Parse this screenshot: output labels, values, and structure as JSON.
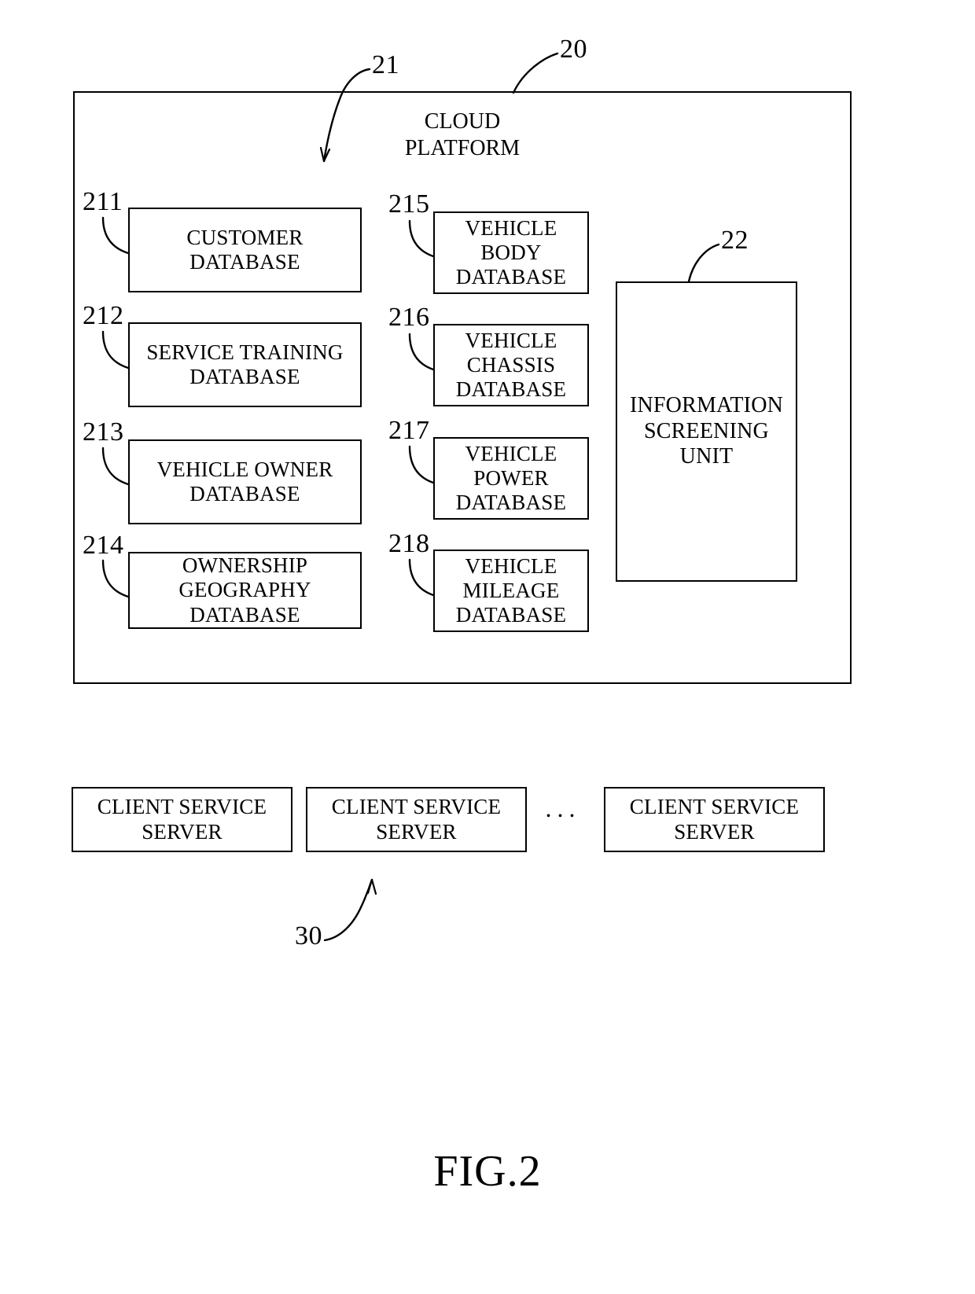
{
  "figure": {
    "caption": "FIG.2"
  },
  "platform": {
    "ref": "20",
    "inner_ref": "21",
    "title": "CLOUD\nPLATFORM"
  },
  "databases_left": [
    {
      "ref": "211",
      "label": "CUSTOMER\nDATABASE"
    },
    {
      "ref": "212",
      "label": "SERVICE TRAINING\nDATABASE"
    },
    {
      "ref": "213",
      "label": "VEHICLE OWNER\nDATABASE"
    },
    {
      "ref": "214",
      "label": "OWNERSHIP\nGEOGRAPHY\nDATABASE"
    }
  ],
  "databases_middle": [
    {
      "ref": "215",
      "label": "VEHICLE\nBODY\nDATABASE"
    },
    {
      "ref": "216",
      "label": "VEHICLE\nCHASSIS\nDATABASE"
    },
    {
      "ref": "217",
      "label": "VEHICLE\nPOWER\nDATABASE"
    },
    {
      "ref": "218",
      "label": "VEHICLE\nMILEAGE\nDATABASE"
    }
  ],
  "screening_unit": {
    "ref": "22",
    "label": "INFORMATION\nSCREENING\nUNIT"
  },
  "servers": {
    "ref": "30",
    "ellipsis": "...",
    "items": [
      {
        "label": "CLIENT SERVICE\nSERVER"
      },
      {
        "label": "CLIENT SERVICE\nSERVER"
      },
      {
        "label": "CLIENT SERVICE\nSERVER"
      }
    ]
  },
  "colors": {
    "line": "#000000",
    "background": "#ffffff"
  }
}
